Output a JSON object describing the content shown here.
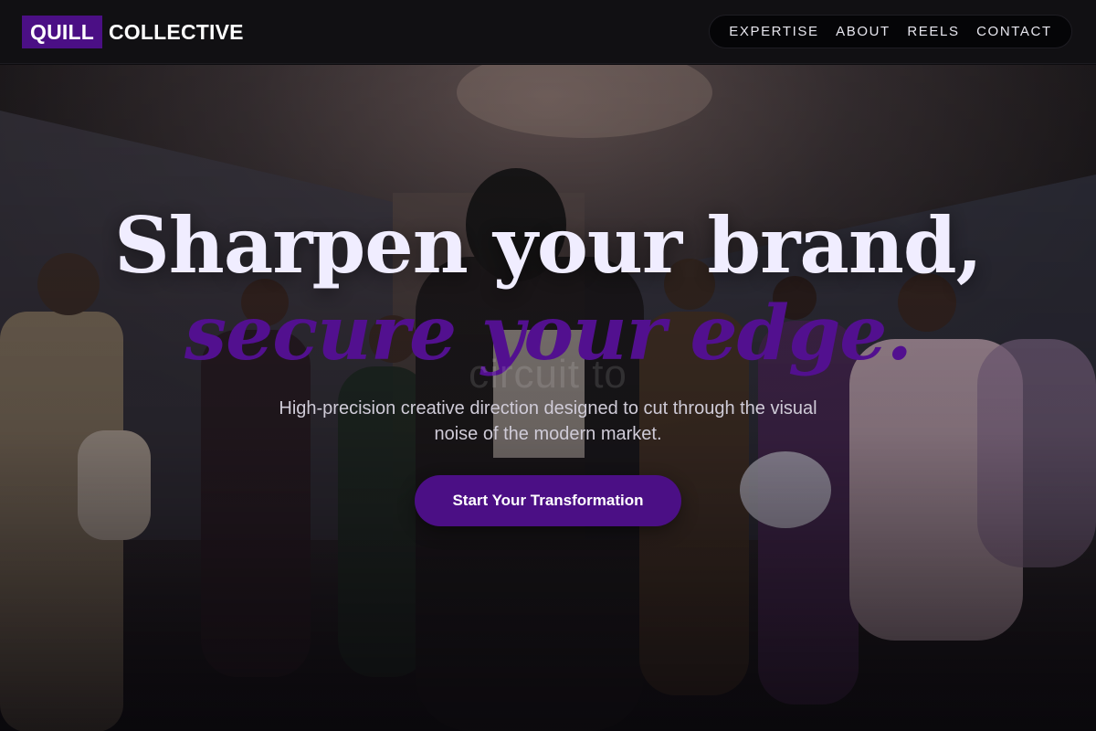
{
  "brand": {
    "mark": "QUILL",
    "word": "COLLECTIVE"
  },
  "nav": {
    "items": [
      {
        "label": "EXPERTISE"
      },
      {
        "label": "ABOUT"
      },
      {
        "label": "REELS"
      },
      {
        "label": "CONTACT"
      }
    ]
  },
  "hero": {
    "headline": "Sharpen your brand,",
    "subheadline": "secure your edge.",
    "ghost_text": "circuit to",
    "description": "High-precision creative direction designed to cut through the visual noise of the modern market.",
    "cta_label": "Start Your Transformation",
    "image_subject": "group of fashion models in a dim studio"
  },
  "colors": {
    "accent": "#4b0f85",
    "header_bg": "#111013",
    "headline": "#f0edff"
  }
}
